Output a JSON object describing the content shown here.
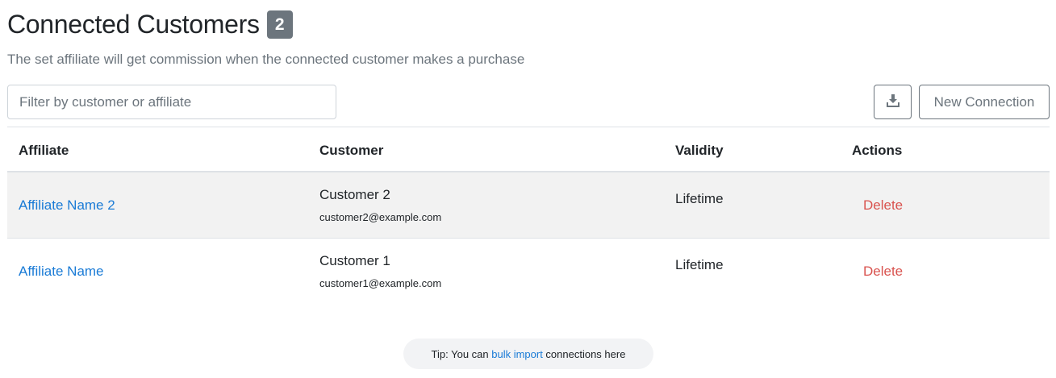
{
  "header": {
    "title": "Connected Customers",
    "count": "2",
    "subtitle": "The set affiliate will get commission when the connected customer makes a purchase"
  },
  "toolbar": {
    "filter_placeholder": "Filter by customer or affiliate",
    "filter_value": "",
    "download_icon": "download-icon",
    "new_connection_label": "New Connection"
  },
  "table": {
    "columns": [
      "Affiliate",
      "Customer",
      "Validity",
      "Actions"
    ],
    "rows": [
      {
        "affiliate": "Affiliate Name 2",
        "customer_name": "Customer 2",
        "customer_email": "customer2@example.com",
        "validity": "Lifetime",
        "action": "Delete"
      },
      {
        "affiliate": "Affiliate Name",
        "customer_name": "Customer 1",
        "customer_email": "customer1@example.com",
        "validity": "Lifetime",
        "action": "Delete"
      }
    ]
  },
  "tip": {
    "prefix": "Tip: You can ",
    "link": "bulk import",
    "suffix": " connections here"
  },
  "colors": {
    "link": "#1a7bd6",
    "danger": "#d9534f",
    "badge": "#6c757d",
    "stripe": "#f2f2f2"
  }
}
